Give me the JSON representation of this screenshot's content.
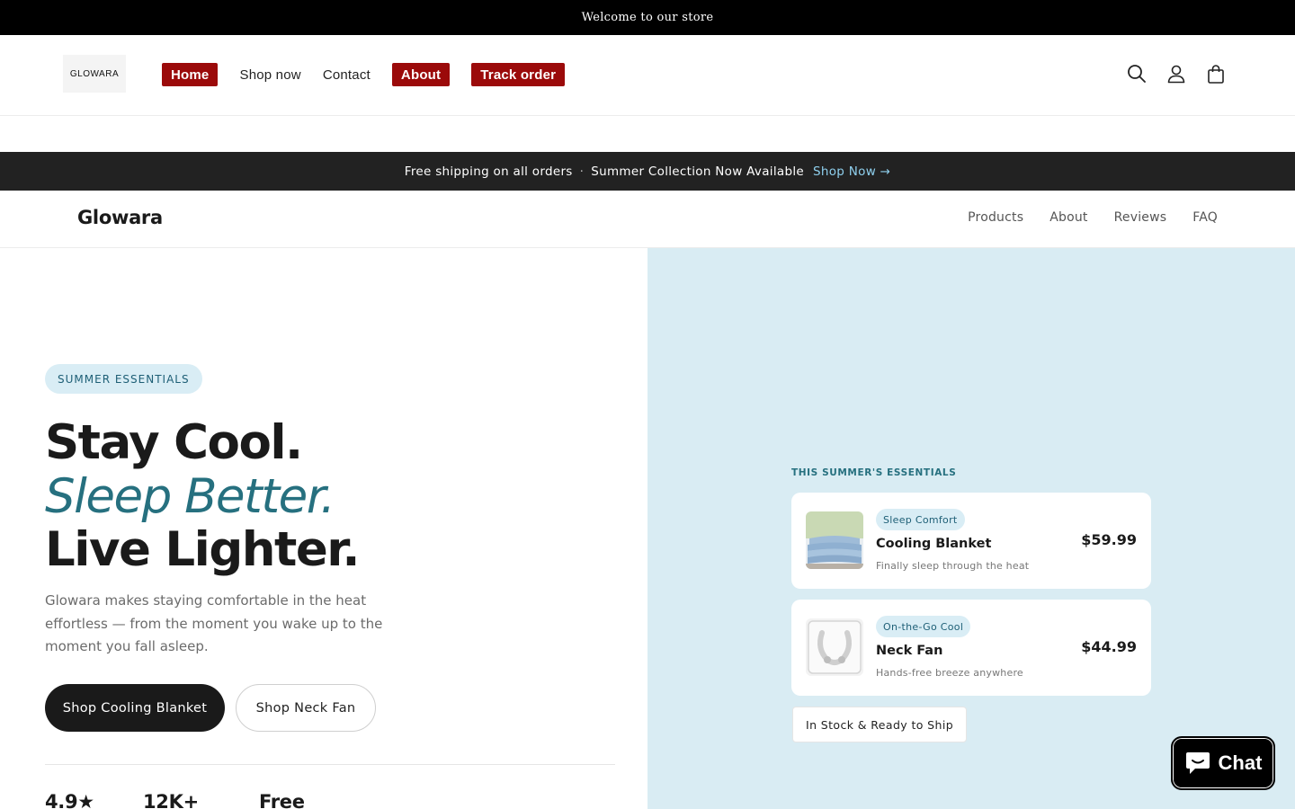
{
  "announcement": {
    "text": "Welcome to our store"
  },
  "header": {
    "logo_text": "GLOWARA",
    "nav": [
      {
        "label": "Home",
        "highlighted": true
      },
      {
        "label": "Shop now",
        "highlighted": false
      },
      {
        "label": "Contact",
        "highlighted": false
      },
      {
        "label": "About",
        "highlighted": true
      },
      {
        "label": "Track order",
        "highlighted": true
      }
    ],
    "icons": [
      "search-icon",
      "account-icon",
      "cart-icon"
    ],
    "highlight_color": "#9b0a0a"
  },
  "promo": {
    "left": "Free shipping on all orders",
    "separator": "·",
    "middle": "Summer Collection Now Available",
    "link": "Shop Now →"
  },
  "subnav": {
    "brand": "Glowara",
    "links": [
      "Products",
      "About",
      "Reviews",
      "FAQ"
    ]
  },
  "hero": {
    "tag": "SUMMER ESSENTIALS",
    "headline_1": "Stay Cool.",
    "headline_2": "Sleep Better.",
    "headline_3": "Live Lighter.",
    "lead": "Glowara makes staying comfortable in the heat effortless — from the moment you wake up to the moment you fall asleep.",
    "primary_button": "Shop Cooling Blanket",
    "secondary_button": "Shop Neck Fan",
    "stats": [
      "4.9★",
      "12K+",
      "Free"
    ]
  },
  "showcase": {
    "title": "THIS SUMMER'S ESSENTIALS",
    "products": [
      {
        "badge": "Sleep Comfort",
        "name": "Cooling Blanket",
        "desc": "Finally sleep through the heat",
        "price": "$59.99"
      },
      {
        "badge": "On-the-Go Cool",
        "name": "Neck Fan",
        "desc": "Hands-free breeze anywhere",
        "price": "$44.99"
      }
    ],
    "stock_label": "In Stock & Ready to Ship",
    "background": "#d9ecf3",
    "accent": "#26707f"
  },
  "chat": {
    "label": "Chat"
  }
}
